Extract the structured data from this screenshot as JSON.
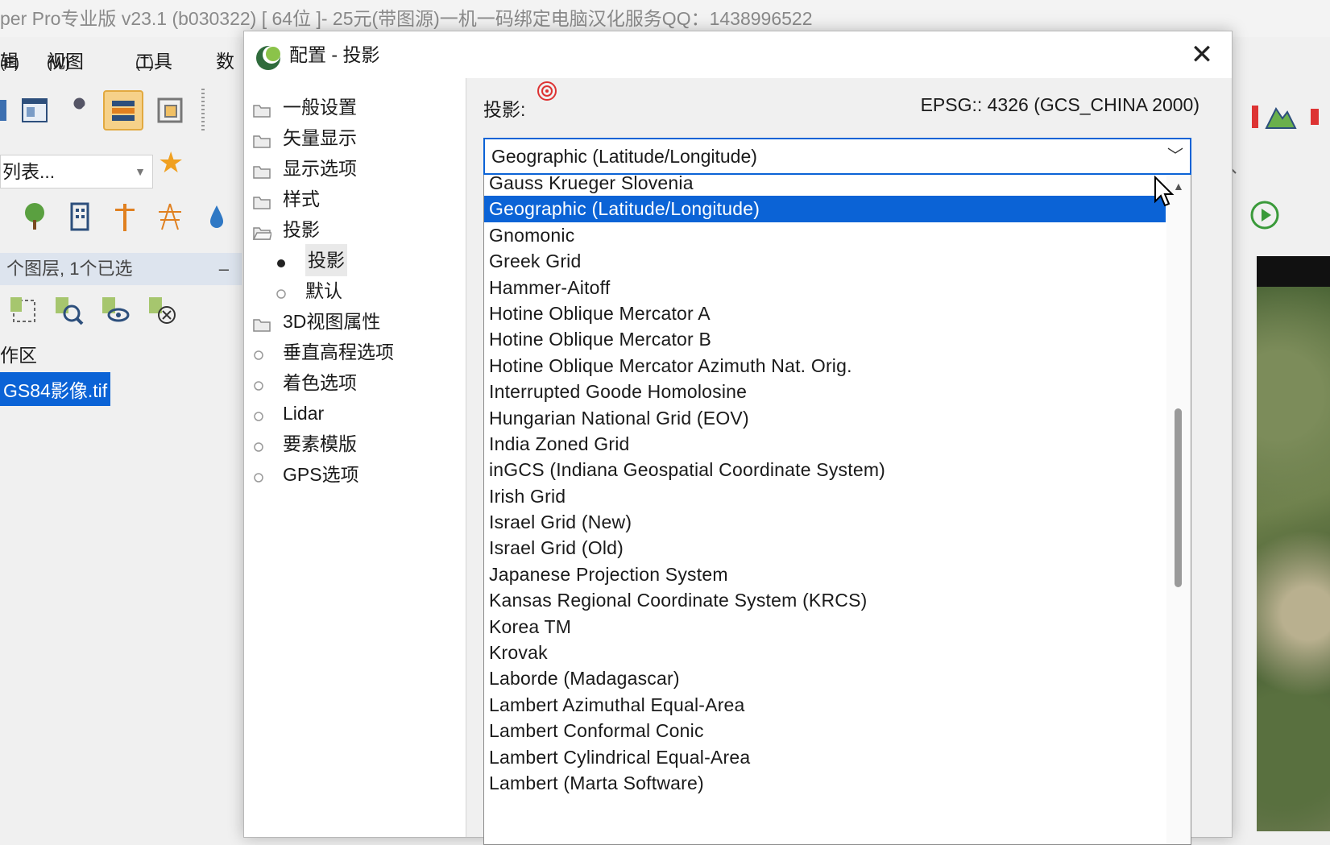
{
  "main_window": {
    "title": "per Pro专业版 v23.1 (b030322) [ 64位 ]-    25元(带图源)一机一码绑定电脑汉化服务QQ：1438996522",
    "menu": [
      {
        "label": "辑",
        "key": "(E)"
      },
      {
        "label": "视图",
        "key": "(W)"
      },
      {
        "label": "工具",
        "key": "(T)"
      },
      {
        "label": "数",
        "key": ""
      }
    ],
    "toolbar_combo": "列表...",
    "layers_panel_header": "个图层, 1个已选",
    "workspace_label": "作区",
    "selected_layer": "GS84影像.tif"
  },
  "dialog": {
    "title": "配置 - 投影",
    "nav": [
      {
        "label": "一般设置",
        "icon": "folder-icon",
        "child": false,
        "current": false
      },
      {
        "label": "矢量显示",
        "icon": "folder-icon",
        "child": false,
        "current": false
      },
      {
        "label": "显示选项",
        "icon": "folder-icon",
        "child": false,
        "current": false
      },
      {
        "label": "样式",
        "icon": "folder-icon",
        "child": false,
        "current": false
      },
      {
        "label": "投影",
        "icon": "folder-open-icon",
        "child": false,
        "current": false
      },
      {
        "label": "投影",
        "icon": "bullet-filled-icon",
        "child": true,
        "current": true
      },
      {
        "label": "默认",
        "icon": "bullet-empty-icon",
        "child": true,
        "current": false
      },
      {
        "label": "3D视图属性",
        "icon": "folder-icon",
        "child": false,
        "current": false
      },
      {
        "label": "垂直高程选项",
        "icon": "bullet-empty-icon",
        "child": false,
        "current": false
      },
      {
        "label": "着色选项",
        "icon": "bullet-empty-icon",
        "child": false,
        "current": false
      },
      {
        "label": "Lidar",
        "icon": "bullet-empty-icon",
        "child": false,
        "current": false
      },
      {
        "label": "要素模版",
        "icon": "bullet-empty-icon",
        "child": false,
        "current": false
      },
      {
        "label": "GPS选项",
        "icon": "bullet-empty-icon",
        "child": false,
        "current": false
      }
    ],
    "projection_label": "投影:",
    "epsg": "EPSG:: 4326 (GCS_CHINA 2000)",
    "selected_projection": "Geographic (Latitude/Longitude)",
    "options": [
      "Gauss Krueger Slovenia",
      "Geographic (Latitude/Longitude)",
      "Gnomonic",
      "Greek Grid",
      "Hammer-Aitoff",
      "Hotine Oblique Mercator A",
      "Hotine Oblique Mercator B",
      "Hotine Oblique Mercator Azimuth Nat. Orig.",
      "Interrupted Goode Homolosine",
      "Hungarian National Grid (EOV)",
      "India Zoned Grid",
      "inGCS (Indiana Geospatial Coordinate System)",
      "Irish Grid",
      "Israel Grid (New)",
      "Israel Grid (Old)",
      "Japanese Projection System",
      "Kansas Regional Coordinate System (KRCS)",
      "Korea TM",
      "Krovak",
      "Laborde (Madagascar)",
      "Lambert Azimuthal Equal-Area",
      "Lambert Conformal Conic",
      "Lambert Cylindrical Equal-Area",
      "Lambert (Marta Software)"
    ],
    "selected_index": 1
  },
  "colors": {
    "selection_blue": "#0b63d6",
    "active_tool": "#f6d189"
  }
}
